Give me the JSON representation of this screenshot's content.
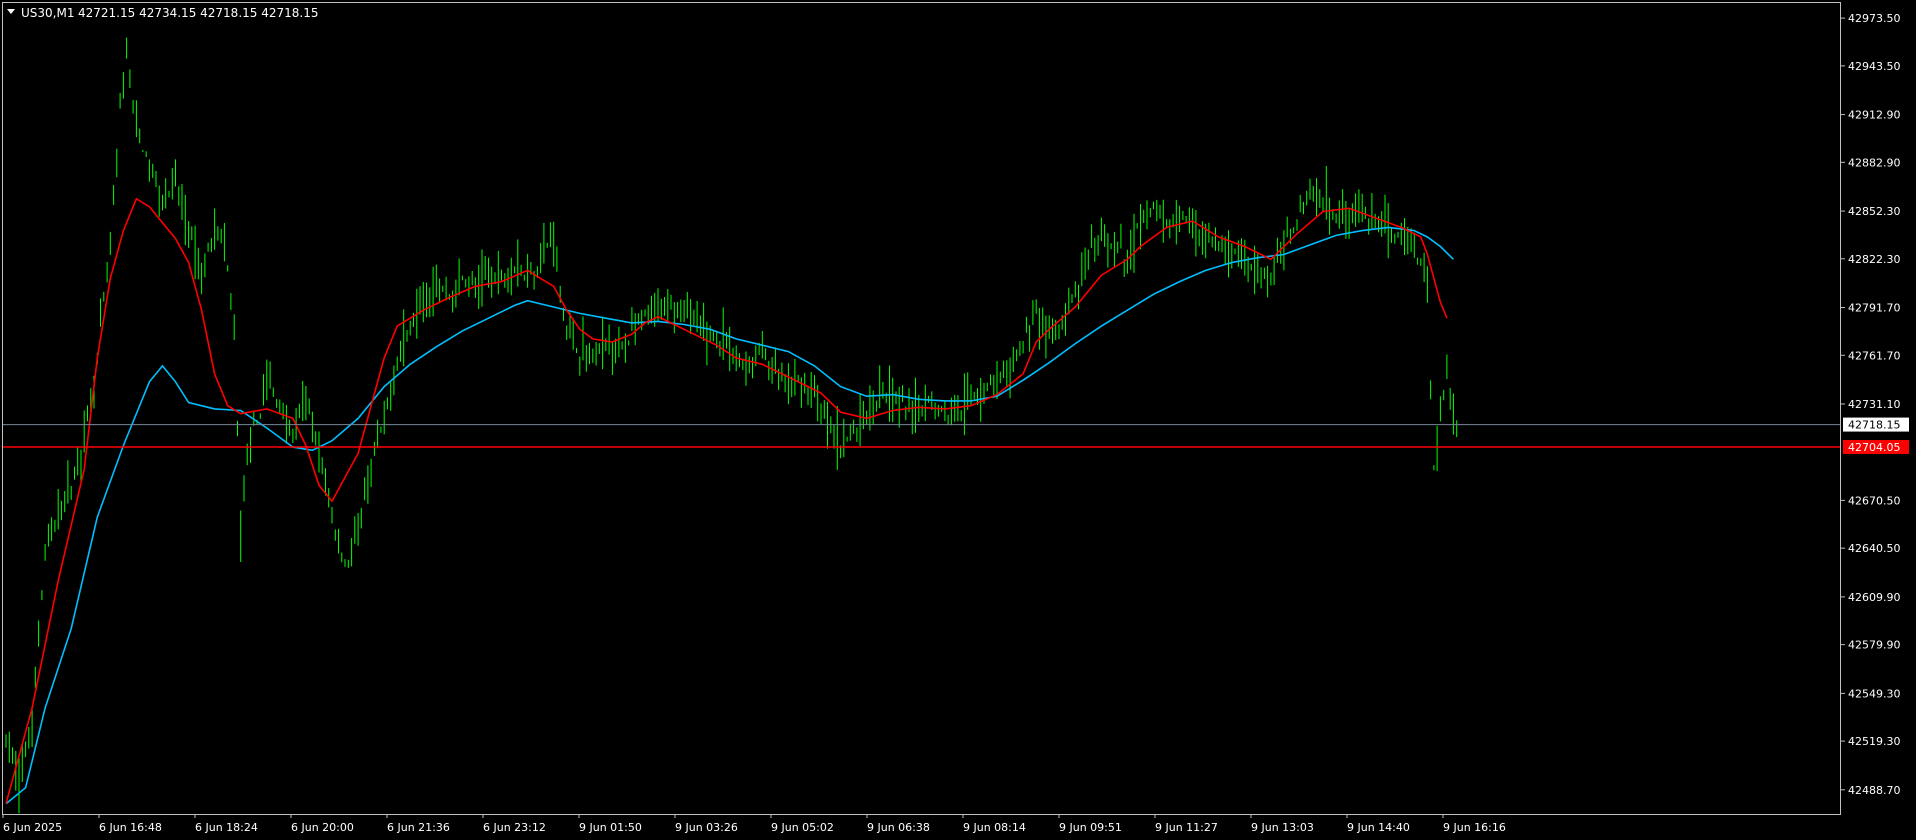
{
  "header": {
    "symbol": "US30,M1",
    "ohlc": "42721.15 42734.15 42718.15 42718.15"
  },
  "colors": {
    "background": "#000000",
    "frame": "#c0c0c0",
    "candles": "#00ff00",
    "ma_fast": "#ff0000",
    "ma_slow": "#00bfff",
    "bid_line": "#778899",
    "level_line": "#ff0000",
    "text": "#ffffff"
  },
  "chart_data": {
    "type": "line",
    "title": "US30,M1",
    "ylim": [
      42473.5,
      42983.0
    ],
    "yticks": [
      42973.5,
      42943.5,
      42912.9,
      42882.9,
      42852.3,
      42822.3,
      42791.7,
      42761.7,
      42731.1,
      42670.5,
      42640.5,
      42609.9,
      42579.9,
      42549.3,
      42519.3,
      42488.7
    ],
    "xticks": [
      "6 Jun 2025",
      "6 Jun 16:48",
      "6 Jun 18:24",
      "6 Jun 20:00",
      "6 Jun 21:36",
      "6 Jun 23:12",
      "9 Jun 01:50",
      "9 Jun 03:26",
      "9 Jun 05:02",
      "9 Jun 06:38",
      "9 Jun 08:14",
      "9 Jun 09:51",
      "9 Jun 11:27",
      "9 Jun 13:03",
      "9 Jun 14:40",
      "9 Jun 16:16"
    ],
    "price_path": [
      [
        0,
        42520
      ],
      [
        4,
        42495
      ],
      [
        8,
        42530
      ],
      [
        12,
        42640
      ],
      [
        16,
        42660
      ],
      [
        20,
        42680
      ],
      [
        24,
        42710
      ],
      [
        28,
        42760
      ],
      [
        32,
        42830
      ],
      [
        35,
        42915
      ],
      [
        37,
        42950
      ],
      [
        40,
        42905
      ],
      [
        44,
        42880
      ],
      [
        48,
        42860
      ],
      [
        52,
        42870
      ],
      [
        56,
        42840
      ],
      [
        60,
        42810
      ],
      [
        64,
        42845
      ],
      [
        67,
        42830
      ],
      [
        70,
        42780
      ],
      [
        72,
        42650
      ],
      [
        74,
        42700
      ],
      [
        77,
        42720
      ],
      [
        80,
        42745
      ],
      [
        84,
        42730
      ],
      [
        88,
        42710
      ],
      [
        92,
        42735
      ],
      [
        96,
        42700
      ],
      [
        100,
        42660
      ],
      [
        104,
        42630
      ],
      [
        108,
        42650
      ],
      [
        112,
        42690
      ],
      [
        116,
        42720
      ],
      [
        120,
        42760
      ],
      [
        124,
        42780
      ],
      [
        128,
        42800
      ],
      [
        132,
        42805
      ],
      [
        136,
        42800
      ],
      [
        140,
        42810
      ],
      [
        144,
        42805
      ],
      [
        148,
        42812
      ],
      [
        152,
        42810
      ],
      [
        156,
        42818
      ],
      [
        160,
        42812
      ],
      [
        164,
        42822
      ],
      [
        168,
        42840
      ],
      [
        170,
        42800
      ],
      [
        172,
        42780
      ],
      [
        176,
        42765
      ],
      [
        180,
        42760
      ],
      [
        184,
        42770
      ],
      [
        188,
        42765
      ],
      [
        192,
        42775
      ],
      [
        196,
        42785
      ],
      [
        200,
        42790
      ],
      [
        204,
        42795
      ],
      [
        208,
        42790
      ],
      [
        212,
        42780
      ],
      [
        216,
        42775
      ],
      [
        220,
        42770
      ],
      [
        224,
        42760
      ],
      [
        228,
        42755
      ],
      [
        232,
        42765
      ],
      [
        236,
        42750
      ],
      [
        240,
        42740
      ],
      [
        244,
        42745
      ],
      [
        248,
        42735
      ],
      [
        252,
        42720
      ],
      [
        256,
        42705
      ],
      [
        260,
        42715
      ],
      [
        264,
        42725
      ],
      [
        268,
        42740
      ],
      [
        272,
        42735
      ],
      [
        276,
        42730
      ],
      [
        280,
        42725
      ],
      [
        284,
        42735
      ],
      [
        288,
        42725
      ],
      [
        292,
        42730
      ],
      [
        296,
        42735
      ],
      [
        300,
        42740
      ],
      [
        304,
        42745
      ],
      [
        308,
        42750
      ],
      [
        312,
        42770
      ],
      [
        316,
        42790
      ],
      [
        320,
        42775
      ],
      [
        324,
        42780
      ],
      [
        328,
        42800
      ],
      [
        332,
        42820
      ],
      [
        336,
        42835
      ],
      [
        340,
        42830
      ],
      [
        344,
        42820
      ],
      [
        348,
        42845
      ],
      [
        352,
        42855
      ],
      [
        356,
        42840
      ],
      [
        360,
        42850
      ],
      [
        364,
        42845
      ],
      [
        368,
        42835
      ],
      [
        372,
        42830
      ],
      [
        376,
        42825
      ],
      [
        380,
        42820
      ],
      [
        384,
        42815
      ],
      [
        388,
        42810
      ],
      [
        392,
        42830
      ],
      [
        396,
        42850
      ],
      [
        400,
        42865
      ],
      [
        404,
        42860
      ],
      [
        408,
        42850
      ],
      [
        412,
        42855
      ],
      [
        416,
        42850
      ],
      [
        420,
        42845
      ],
      [
        424,
        42840
      ],
      [
        428,
        42835
      ],
      [
        432,
        42830
      ],
      [
        436,
        42810
      ],
      [
        437,
        42740
      ],
      [
        438,
        42690
      ],
      [
        439,
        42700
      ],
      [
        440,
        42730
      ],
      [
        442,
        42750
      ],
      [
        444,
        42725
      ],
      [
        445,
        42718.15
      ]
    ],
    "ma_fast": [
      [
        0,
        42480
      ],
      [
        8,
        42540
      ],
      [
        16,
        42620
      ],
      [
        24,
        42690
      ],
      [
        28,
        42760
      ],
      [
        32,
        42810
      ],
      [
        36,
        42840
      ],
      [
        40,
        42860
      ],
      [
        44,
        42855
      ],
      [
        48,
        42845
      ],
      [
        52,
        42835
      ],
      [
        56,
        42820
      ],
      [
        60,
        42790
      ],
      [
        64,
        42750
      ],
      [
        68,
        42730
      ],
      [
        72,
        42725
      ],
      [
        80,
        42728
      ],
      [
        88,
        42722
      ],
      [
        92,
        42705
      ],
      [
        96,
        42680
      ],
      [
        100,
        42670
      ],
      [
        104,
        42685
      ],
      [
        108,
        42700
      ],
      [
        112,
        42730
      ],
      [
        116,
        42760
      ],
      [
        120,
        42780
      ],
      [
        128,
        42790
      ],
      [
        136,
        42798
      ],
      [
        144,
        42805
      ],
      [
        152,
        42808
      ],
      [
        160,
        42815
      ],
      [
        164,
        42810
      ],
      [
        168,
        42805
      ],
      [
        172,
        42790
      ],
      [
        176,
        42778
      ],
      [
        180,
        42772
      ],
      [
        186,
        42770
      ],
      [
        192,
        42775
      ],
      [
        196,
        42782
      ],
      [
        200,
        42786
      ],
      [
        204,
        42782
      ],
      [
        208,
        42778
      ],
      [
        212,
        42774
      ],
      [
        218,
        42768
      ],
      [
        224,
        42760
      ],
      [
        232,
        42756
      ],
      [
        238,
        42750
      ],
      [
        244,
        42744
      ],
      [
        250,
        42738
      ],
      [
        256,
        42726
      ],
      [
        264,
        42722
      ],
      [
        272,
        42727
      ],
      [
        280,
        42729
      ],
      [
        288,
        42728
      ],
      [
        296,
        42730
      ],
      [
        304,
        42737
      ],
      [
        312,
        42750
      ],
      [
        316,
        42770
      ],
      [
        320,
        42778
      ],
      [
        328,
        42792
      ],
      [
        336,
        42812
      ],
      [
        344,
        42822
      ],
      [
        348,
        42830
      ],
      [
        356,
        42842
      ],
      [
        364,
        42846
      ],
      [
        372,
        42836
      ],
      [
        380,
        42830
      ],
      [
        388,
        42822
      ],
      [
        396,
        42838
      ],
      [
        404,
        42852
      ],
      [
        412,
        42854
      ],
      [
        420,
        42848
      ],
      [
        428,
        42842
      ],
      [
        434,
        42836
      ],
      [
        436,
        42825
      ],
      [
        438,
        42810
      ],
      [
        440,
        42795
      ],
      [
        442,
        42785
      ]
    ],
    "ma_slow": [
      [
        0,
        42480
      ],
      [
        6,
        42490
      ],
      [
        12,
        42540
      ],
      [
        20,
        42590
      ],
      [
        28,
        42660
      ],
      [
        36,
        42705
      ],
      [
        44,
        42745
      ],
      [
        48,
        42755
      ],
      [
        52,
        42745
      ],
      [
        56,
        42732
      ],
      [
        64,
        42728
      ],
      [
        72,
        42727
      ],
      [
        80,
        42716
      ],
      [
        88,
        42704
      ],
      [
        94,
        42702
      ],
      [
        100,
        42708
      ],
      [
        108,
        42722
      ],
      [
        116,
        42742
      ],
      [
        124,
        42756
      ],
      [
        132,
        42767
      ],
      [
        140,
        42777
      ],
      [
        148,
        42785
      ],
      [
        156,
        42793
      ],
      [
        160,
        42796
      ],
      [
        168,
        42792
      ],
      [
        176,
        42788
      ],
      [
        184,
        42785
      ],
      [
        192,
        42782
      ],
      [
        200,
        42783
      ],
      [
        208,
        42781
      ],
      [
        216,
        42778
      ],
      [
        224,
        42772
      ],
      [
        232,
        42768
      ],
      [
        240,
        42764
      ],
      [
        248,
        42755
      ],
      [
        256,
        42742
      ],
      [
        264,
        42736
      ],
      [
        272,
        42737
      ],
      [
        280,
        42734
      ],
      [
        288,
        42733
      ],
      [
        296,
        42733
      ],
      [
        304,
        42736
      ],
      [
        312,
        42746
      ],
      [
        320,
        42757
      ],
      [
        328,
        42769
      ],
      [
        336,
        42780
      ],
      [
        344,
        42790
      ],
      [
        352,
        42800
      ],
      [
        360,
        42808
      ],
      [
        368,
        42815
      ],
      [
        376,
        42820
      ],
      [
        384,
        42823
      ],
      [
        392,
        42825
      ],
      [
        400,
        42831
      ],
      [
        408,
        42837
      ],
      [
        416,
        42840
      ],
      [
        424,
        42842
      ],
      [
        432,
        42840
      ],
      [
        436,
        42836
      ],
      [
        440,
        42830
      ],
      [
        444,
        42822
      ]
    ],
    "bid_price": 42718.15,
    "bid_label": "42718.15",
    "level_price": 42704.05,
    "level_label": "42704.05"
  }
}
